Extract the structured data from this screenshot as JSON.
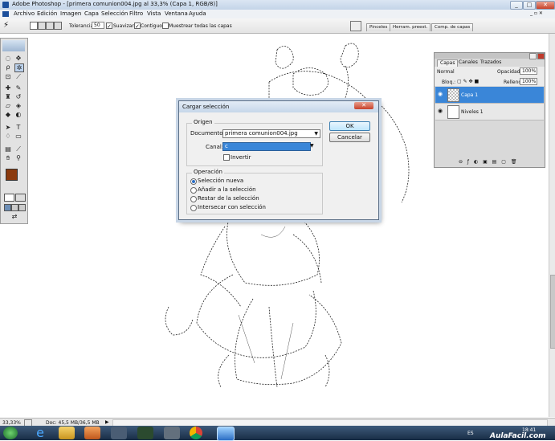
{
  "window": {
    "title": "Adobe Photoshop - [primera comunion004.jpg al 33,3% (Capa 1, RGB/8)]",
    "min_label": "_",
    "max_label": "□",
    "close_label": "✕"
  },
  "menu": {
    "items": [
      "Archivo",
      "Edición",
      "Imagen",
      "Capa",
      "Selección",
      "Filtro",
      "Vista",
      "Ventana",
      "Ayuda"
    ]
  },
  "options": {
    "tolerance_label": "Tolerancia:",
    "tolerance_value": "50",
    "smooth_label": "Suavizar",
    "contiguous_label": "Contiguo",
    "sample_all_label": "Muestrear todas las capas",
    "well_tabs": [
      "Pinceles",
      "Herram. preest.",
      "Comp. de capas"
    ]
  },
  "dialog": {
    "title": "Cargar selección",
    "origin_label": "Origen",
    "document_label": "Documento:",
    "document_value": "primera comunion004.jpg",
    "channel_label": "Canal:",
    "channel_value": "c",
    "invert_label": "Invertir",
    "operation_label": "Operación",
    "operations": [
      "Selección nueva",
      "Añadir a la selección",
      "Restar de la selección",
      "Intersecar con selección"
    ],
    "selected_operation": "Selección nueva",
    "ok_label": "OK",
    "cancel_label": "Cancelar"
  },
  "layers_panel": {
    "tabs": [
      "Capas",
      "Canales",
      "Trazados"
    ],
    "blend_mode": "Normal",
    "opacity_label": "Opacidad:",
    "opacity_value": "100%",
    "lock_label": "Bloq.:",
    "fill_label": "Relleno:",
    "fill_value": "100%",
    "layers": [
      "Capa 1",
      "Niveles 1"
    ],
    "selected_layer": "Capa 1"
  },
  "statusbar": {
    "zoom": "33,33%",
    "doc_info": "Doc: 45,5 MB/36,5 MB"
  },
  "taskbar": {
    "language": "ES",
    "time": "18:41",
    "watermark": "AulaFacil.com"
  },
  "colors": {
    "foreground": "#8b3a0e",
    "background": "#ffffff",
    "selection": "#3a86d8",
    "accent": "#1b4f9c"
  },
  "icons": [
    "photoshop-logo",
    "magic-wand-icon",
    "eye-icon",
    "windows-start-icon",
    "ie-icon",
    "folder-icon",
    "media-icon",
    "chrome-icon"
  ]
}
